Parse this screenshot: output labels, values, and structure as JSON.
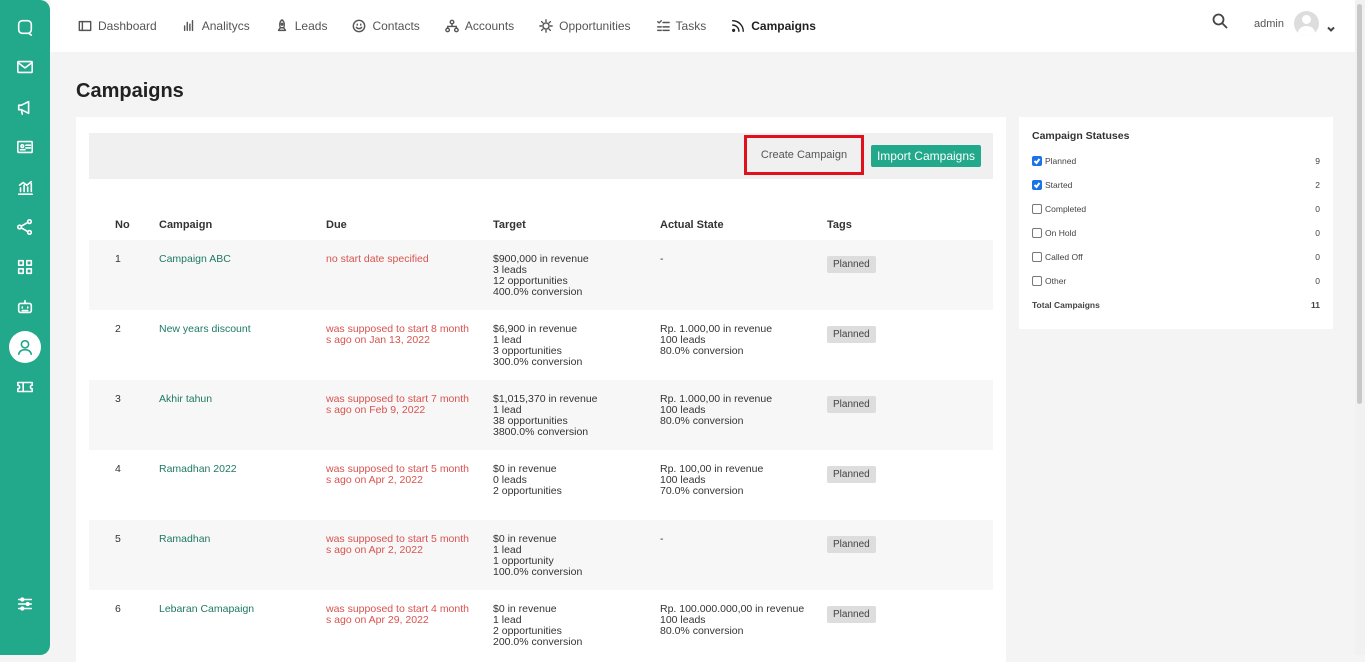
{
  "nav": {
    "items": [
      {
        "label": "Dashboard",
        "icon": "dashboard-icon"
      },
      {
        "label": "Analitycs",
        "icon": "bar-chart-icon"
      },
      {
        "label": "Leads",
        "icon": "rocket-icon"
      },
      {
        "label": "Contacts",
        "icon": "smile-icon"
      },
      {
        "label": "Accounts",
        "icon": "org-icon"
      },
      {
        "label": "Opportunities",
        "icon": "bulb-icon"
      },
      {
        "label": "Tasks",
        "icon": "checklist-icon"
      },
      {
        "label": "Campaigns",
        "icon": "rss-icon"
      }
    ],
    "active": "Campaigns",
    "username": "admin"
  },
  "sidebar": {
    "icons": [
      "chat-icon",
      "mail-icon",
      "megaphone-icon",
      "id-card-icon",
      "analytics-icon",
      "share-icon",
      "grid-icon",
      "robot-icon",
      "user-icon",
      "ticket-icon",
      "settings-sliders-icon"
    ],
    "active": "user-icon"
  },
  "page": {
    "title": "Campaigns"
  },
  "toolbar": {
    "create_label": "Create Campaign",
    "import_label": "Import Campaigns"
  },
  "table": {
    "headers": [
      "No",
      "Campaign",
      "Due",
      "Target",
      "Actual State",
      "Tags"
    ],
    "rows": [
      {
        "no": "1",
        "campaign": "Campaign ABC",
        "due": "no start date specified",
        "target": [
          "$900,000 in revenue",
          "3 leads",
          "12 opportunities",
          "400.0% conversion"
        ],
        "actual": [
          "-"
        ],
        "tag": "Planned"
      },
      {
        "no": "2",
        "campaign": "New years discount",
        "due": "was supposed to start 8 months ago on Jan 13, 2022",
        "target": [
          "$6,900 in revenue",
          "1 lead",
          "3 opportunities",
          "300.0% conversion"
        ],
        "actual": [
          "Rp. 1.000,00 in revenue",
          "100 leads",
          "80.0% conversion"
        ],
        "tag": "Planned"
      },
      {
        "no": "3",
        "campaign": "Akhir tahun",
        "due": "was supposed to start 7 months ago on Feb 9, 2022",
        "target": [
          "$1,015,370 in revenue",
          "1 lead",
          "38 opportunities",
          "3800.0% conversion"
        ],
        "actual": [
          "Rp. 1.000,00 in revenue",
          "100 leads",
          "80.0% conversion"
        ],
        "tag": "Planned"
      },
      {
        "no": "4",
        "campaign": "Ramadhan 2022",
        "due": "was supposed to start 5 months ago on Apr 2, 2022",
        "target": [
          "$0 in revenue",
          "0 leads",
          "2 opportunities"
        ],
        "actual": [
          "Rp. 100,00 in revenue",
          "100 leads",
          "70.0% conversion"
        ],
        "tag": "Planned"
      },
      {
        "no": "5",
        "campaign": "Ramadhan",
        "due": "was supposed to start 5 months ago on Apr 2, 2022",
        "target": [
          "$0 in revenue",
          "1 lead",
          "1 opportunity",
          "100.0% conversion"
        ],
        "actual": [
          "-"
        ],
        "tag": "Planned"
      },
      {
        "no": "6",
        "campaign": "Lebaran Camapaign",
        "due": "was supposed to start 4 months ago on Apr 29, 2022",
        "target": [
          "$0 in revenue",
          "1 lead",
          "2 opportunities",
          "200.0% conversion"
        ],
        "actual": [
          "Rp. 100.000.000,00 in revenue",
          "100 leads",
          "80.0% conversion"
        ],
        "tag": "Planned"
      }
    ]
  },
  "statuses": {
    "title": "Campaign Statuses",
    "items": [
      {
        "label": "Planned",
        "count": "9",
        "checked": true
      },
      {
        "label": "Started",
        "count": "2",
        "checked": true
      },
      {
        "label": "Completed",
        "count": "0",
        "checked": false
      },
      {
        "label": "On Hold",
        "count": "0",
        "checked": false
      },
      {
        "label": "Called Off",
        "count": "0",
        "checked": false
      },
      {
        "label": "Other",
        "count": "0",
        "checked": false
      }
    ],
    "total_label": "Total Campaigns",
    "total_count": "11"
  }
}
